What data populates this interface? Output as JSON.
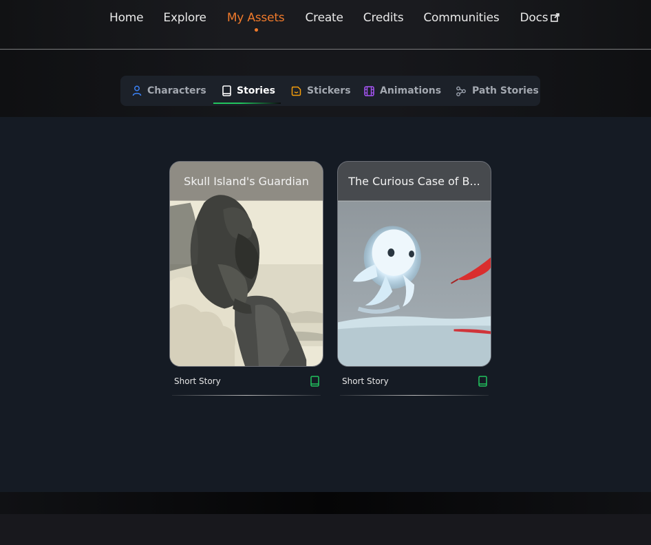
{
  "nav": {
    "items": [
      {
        "label": "Home"
      },
      {
        "label": "Explore"
      },
      {
        "label": "My Assets",
        "active": true
      },
      {
        "label": "Create"
      },
      {
        "label": "Credits"
      },
      {
        "label": "Communities"
      },
      {
        "label": "Docs",
        "icon": "external-link-icon"
      }
    ]
  },
  "tabs": [
    {
      "label": "Characters",
      "icon": "user-icon",
      "color": "#3b82f6"
    },
    {
      "label": "Stories",
      "icon": "book-icon",
      "color": "#ffffff",
      "active": true
    },
    {
      "label": "Stickers",
      "icon": "sticker-icon",
      "color": "#f59e0b"
    },
    {
      "label": "Animations",
      "icon": "film-icon",
      "color": "#a855f7"
    },
    {
      "label": "Path Stories",
      "icon": "path-icon",
      "color": "#9ca3af"
    }
  ],
  "cards": [
    {
      "title": "Skull Island's Guardian",
      "type": "Short Story",
      "image": "gorilla-on-cliff-illustration"
    },
    {
      "title": "The Curious Case of B...",
      "type": "Short Story",
      "image": "ghost-spirit-with-red-feather-illustration"
    }
  ],
  "colors": {
    "accent": "#f07a2b",
    "active_tab_underline": "#22c55e",
    "book_icon": "#22c55e"
  }
}
